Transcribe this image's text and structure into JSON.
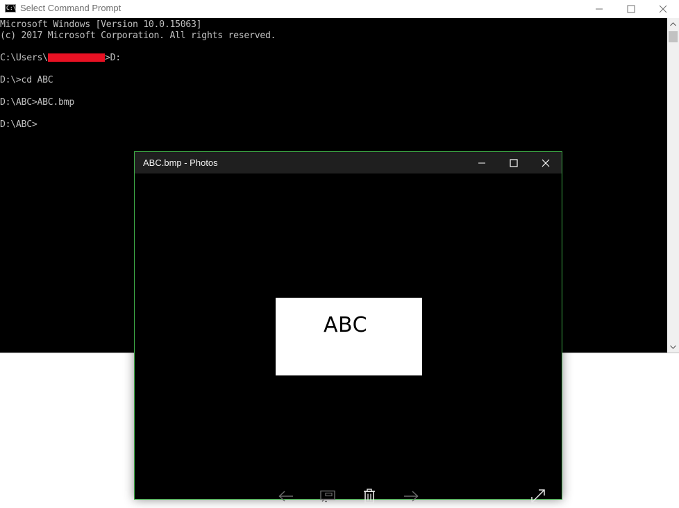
{
  "cmd": {
    "title": "Select Command Prompt",
    "app_icon_text": "C:\\",
    "lines": [
      "Microsoft Windows [Version 10.0.15063]",
      "(c) 2017 Microsoft Corporation. All rights reserved.",
      "",
      "C:\\Users\\",
      ">D:",
      "",
      "D:\\>cd ABC",
      "",
      "D:\\ABC>ABC.bmp",
      "",
      "D:\\ABC>"
    ],
    "redaction_color": "#e81123"
  },
  "photos": {
    "title": "ABC.bmp - Photos",
    "image_text": "ABC",
    "border_color": "#3fae48",
    "toolbar": [
      "previous-arrow-icon",
      "slideshow-icon",
      "delete-icon",
      "next-arrow-icon",
      "fullscreen-icon"
    ]
  },
  "window_controls": [
    "minimize-icon",
    "maximize-icon",
    "close-icon"
  ]
}
